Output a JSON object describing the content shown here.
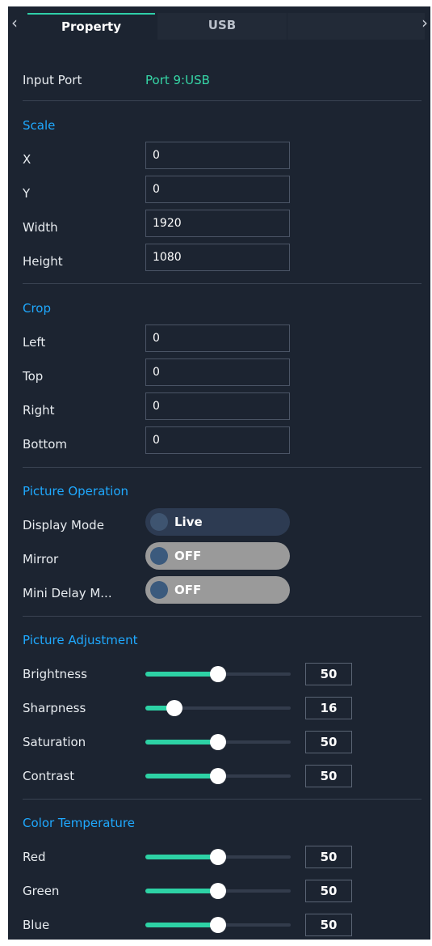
{
  "tabs": {
    "property": "Property",
    "usb": "USB"
  },
  "nav": {
    "left_icon": "chevron-left-icon",
    "right_icon": "chevron-right-icon"
  },
  "input_port": {
    "label": "Input Port",
    "value": "Port 9:USB"
  },
  "scale": {
    "title": "Scale",
    "x": {
      "label": "X",
      "value": "0"
    },
    "y": {
      "label": "Y",
      "value": "0"
    },
    "width": {
      "label": "Width",
      "value": "1920"
    },
    "height": {
      "label": "Height",
      "value": "1080"
    }
  },
  "crop": {
    "title": "Crop",
    "left": {
      "label": "Left",
      "value": "0"
    },
    "top": {
      "label": "Top",
      "value": "0"
    },
    "right": {
      "label": "Right",
      "value": "0"
    },
    "bottom": {
      "label": "Bottom",
      "value": "0"
    }
  },
  "picture_operation": {
    "title": "Picture Operation",
    "display_mode": {
      "label": "Display Mode",
      "value": "Live"
    },
    "mirror": {
      "label": "Mirror",
      "value": "OFF"
    },
    "mini_delay": {
      "label": "Mini Delay M...",
      "value": "OFF"
    }
  },
  "picture_adjustment": {
    "title": "Picture Adjustment",
    "brightness": {
      "label": "Brightness",
      "value": "50",
      "fraction": 0.5
    },
    "sharpness": {
      "label": "Sharpness",
      "value": "16",
      "fraction": 0.2
    },
    "saturation": {
      "label": "Saturation",
      "value": "50",
      "fraction": 0.5
    },
    "contrast": {
      "label": "Contrast",
      "value": "50",
      "fraction": 0.5
    }
  },
  "color_temperature": {
    "title": "Color Temperature",
    "red": {
      "label": "Red",
      "value": "50",
      "fraction": 0.5
    },
    "green": {
      "label": "Green",
      "value": "50",
      "fraction": 0.5
    },
    "blue": {
      "label": "Blue",
      "value": "50",
      "fraction": 0.5
    }
  },
  "colors": {
    "accent": "#2dd2a5",
    "section": "#1fa9ff",
    "panel": "#1c2431"
  }
}
